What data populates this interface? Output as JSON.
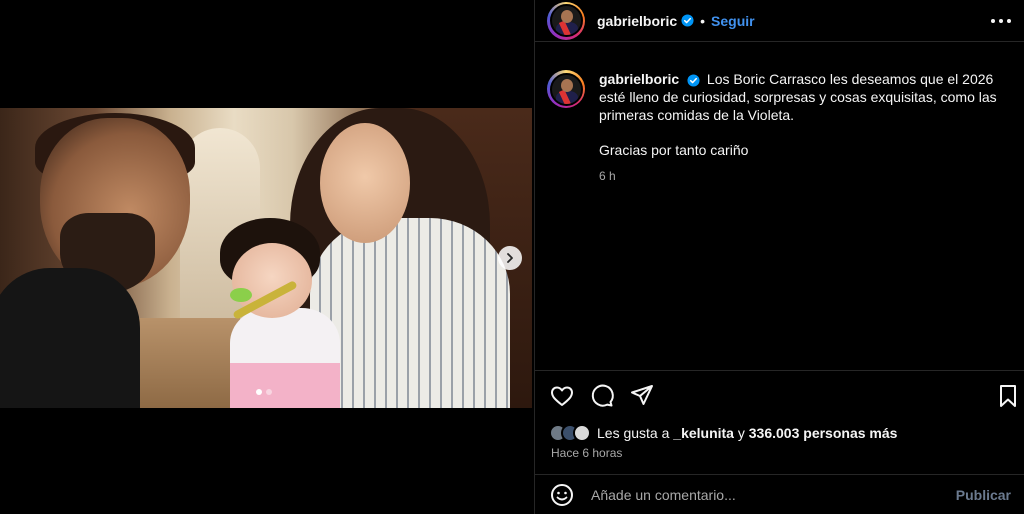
{
  "post": {
    "username": "gabrielboric",
    "separator": "•",
    "follow_label": "Seguir",
    "caption_text": "Los Boric Carrasco les deseamos que el 2026 esté lleno de curiosidad, sorpresas y cosas exquisitas, como las primeras comidas de la Violeta.",
    "caption_line2": "Gracias por tanto cariño",
    "caption_time": "6 h",
    "likes_prefix": "Les gusta a ",
    "likes_user": "_kelunita",
    "likes_suffix": " y ",
    "likes_count": "336.003 personas más",
    "posted_ago": "Hace 6 horas"
  },
  "carousel": {
    "current": 1,
    "total": 2
  },
  "comment": {
    "placeholder": "Añade un comentario...",
    "publish_label": "Publicar"
  },
  "icons": {
    "verified": "verified-badge-icon",
    "more": "more-options-icon",
    "like": "heart-icon",
    "comment": "comment-bubble-icon",
    "share": "paper-plane-icon",
    "save": "bookmark-icon",
    "emoji": "emoji-face-icon",
    "next": "chevron-right-icon"
  },
  "colors": {
    "background": "#000000",
    "link_blue": "#4192ef",
    "muted": "#a8a8a8",
    "verified": "#0095f6"
  }
}
